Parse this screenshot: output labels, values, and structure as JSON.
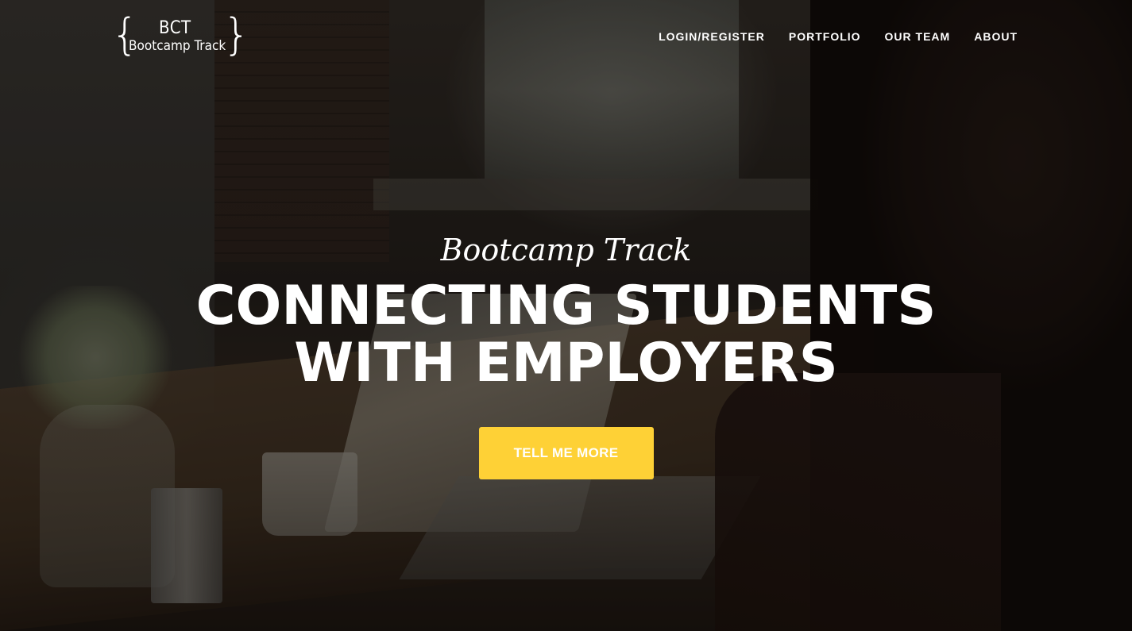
{
  "brand": {
    "abbr": "BCT",
    "name": "Bootcamp Track"
  },
  "nav": {
    "items": [
      {
        "label": "LOGIN/REGISTER"
      },
      {
        "label": "PORTFOLIO"
      },
      {
        "label": "OUR TEAM"
      },
      {
        "label": "ABOUT"
      }
    ]
  },
  "hero": {
    "lead": "Bootcamp Track",
    "heading": "CONNECTING STUDENTS WITH EMPLOYERS",
    "cta_label": "TELL ME MORE"
  },
  "colors": {
    "cta_background": "#fed136",
    "text": "#ffffff"
  }
}
